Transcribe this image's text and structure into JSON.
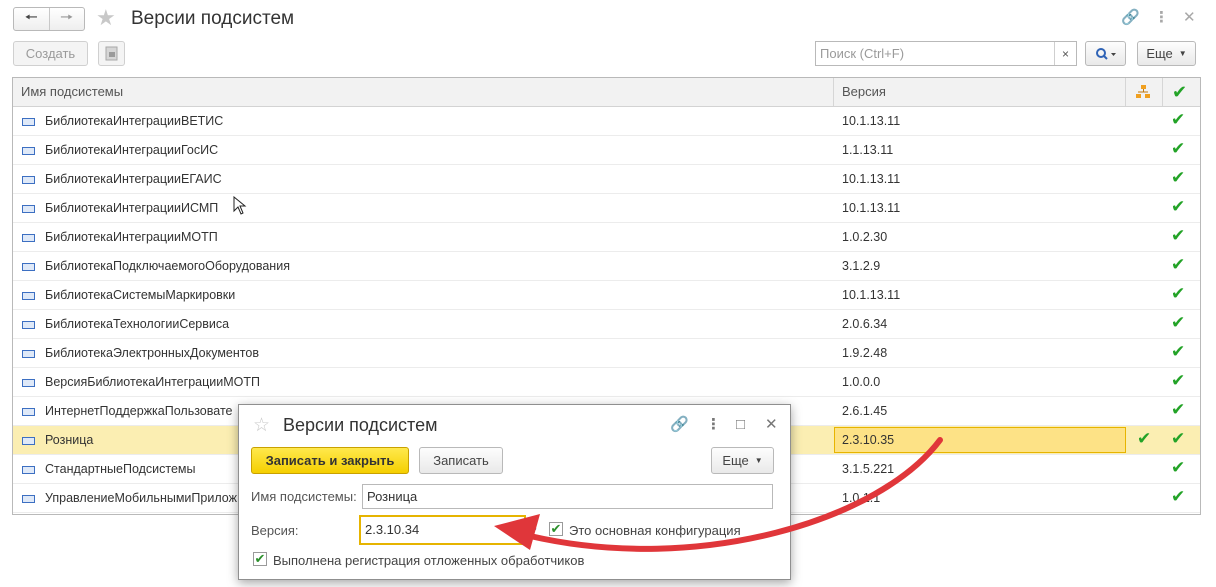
{
  "window": {
    "title": "Версии подсистем"
  },
  "toolbar": {
    "create_label": "Создать",
    "search_placeholder": "Поиск (Ctrl+F)",
    "search_clear": "×",
    "more_label": "Еще"
  },
  "table": {
    "columns": [
      "Имя подсистемы",
      "Версия"
    ],
    "rows": [
      {
        "name": "БиблиотекаИнтеграцииВЕТИС",
        "version": "10.1.13.11"
      },
      {
        "name": "БиблиотекаИнтеграцииГосИС",
        "version": "1.1.13.11"
      },
      {
        "name": "БиблиотекаИнтеграцииЕГАИС",
        "version": "10.1.13.11"
      },
      {
        "name": "БиблиотекаИнтеграцииИСМП",
        "version": "10.1.13.11"
      },
      {
        "name": "БиблиотекаИнтеграцииМОТП",
        "version": "1.0.2.30"
      },
      {
        "name": "БиблиотекаПодключаемогоОборудования",
        "version": "3.1.2.9"
      },
      {
        "name": "БиблиотекаСистемыМаркировки",
        "version": "10.1.13.11"
      },
      {
        "name": "БиблиотекаТехнологииСервиса",
        "version": "2.0.6.34"
      },
      {
        "name": "БиблиотекаЭлектронныхДокументов",
        "version": "1.9.2.48"
      },
      {
        "name": "ВерсияБиблиотекаИнтеграцииМОТП",
        "version": "1.0.0.0"
      },
      {
        "name": "ИнтернетПоддержкаПользовате",
        "version": "2.6.1.45"
      },
      {
        "name": "Розница",
        "version": "2.3.10.35"
      },
      {
        "name": "СтандартныеПодсистемы",
        "version": "3.1.5.221"
      },
      {
        "name": "УправлениеМобильнымиПрилож",
        "version": "1.0.1.1"
      }
    ],
    "selected_row": 11
  },
  "dialog": {
    "title": "Версии подсистем",
    "save_close_label": "Записать и закрыть",
    "save_label": "Записать",
    "more_label": "Еще",
    "name_label": "Имя подсистемы:",
    "name_value": "Розница",
    "version_label": "Версия:",
    "version_value": "2.3.10.34",
    "help_mark": "?",
    "main_config_label": "Это основная конфигурация",
    "main_config_checked": true,
    "deferred_label": "Выполнена регистрация отложенных обработчиков",
    "deferred_checked": true
  },
  "colors": {
    "accent_yellow": "#f5cf00",
    "selected_row": "#fbeeb2",
    "check_green": "#23a327",
    "arrow_red": "#e0363a"
  }
}
